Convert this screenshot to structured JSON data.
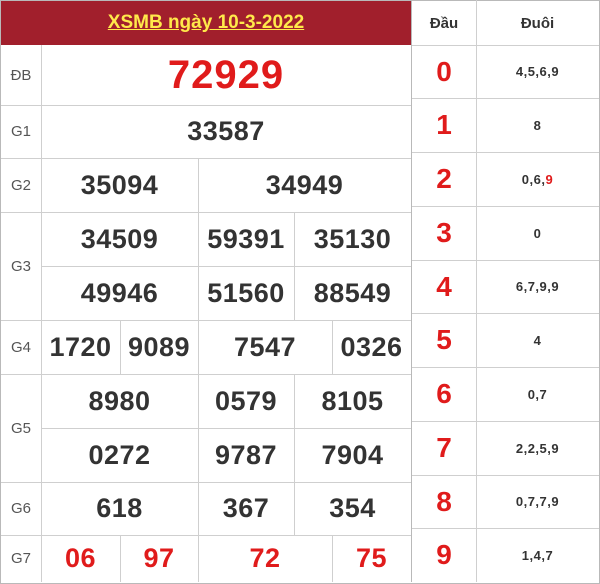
{
  "title": "XSMB ngày 10-3-2022",
  "labels": {
    "db": "ĐB",
    "g1": "G1",
    "g2": "G2",
    "g3": "G3",
    "g4": "G4",
    "g5": "G5",
    "g6": "G6",
    "g7": "G7"
  },
  "prizes": {
    "db": "72929",
    "g1": "33587",
    "g2": [
      "35094",
      "34949"
    ],
    "g3": [
      "34509",
      "59391",
      "35130",
      "49946",
      "51560",
      "88549"
    ],
    "g4": [
      "1720",
      "9089",
      "7547",
      "0326"
    ],
    "g5": [
      "8980",
      "0579",
      "8105",
      "0272",
      "9787",
      "7904"
    ],
    "g6": [
      "618",
      "367",
      "354"
    ],
    "g7": [
      "06",
      "97",
      "72",
      "75"
    ]
  },
  "loto": {
    "head_label": "Đầu",
    "tail_label": "Đuôi",
    "rows": [
      {
        "dau": "0",
        "duoi": "4,5,6,9"
      },
      {
        "dau": "1",
        "duoi": "8"
      },
      {
        "dau": "2",
        "duoi_main": "0,6,",
        "duoi_special": "9"
      },
      {
        "dau": "3",
        "duoi": "0"
      },
      {
        "dau": "4",
        "duoi": "6,7,9,9"
      },
      {
        "dau": "5",
        "duoi": "4"
      },
      {
        "dau": "6",
        "duoi": "0,7"
      },
      {
        "dau": "7",
        "duoi": "2,2,5,9"
      },
      {
        "dau": "8",
        "duoi": "0,7,7,9"
      },
      {
        "dau": "9",
        "duoi": "1,4,7"
      }
    ]
  },
  "colors": {
    "title_bg": "#a11f2c",
    "title_text": "#ffe94a",
    "special": "#e01b1b",
    "number": "#333333"
  }
}
